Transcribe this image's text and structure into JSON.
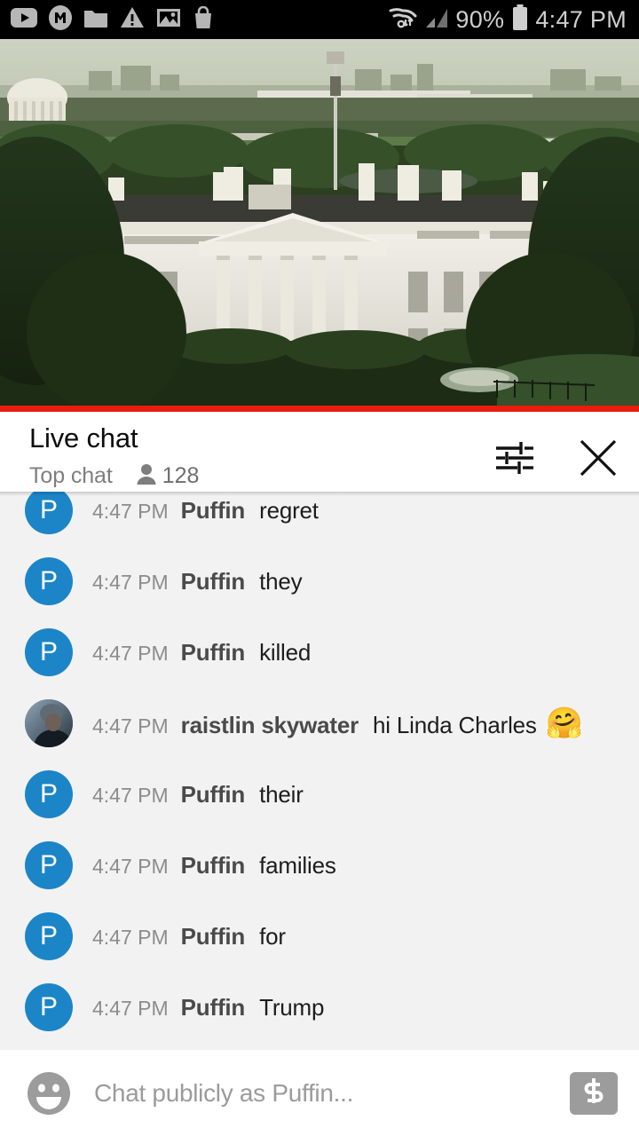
{
  "status_bar": {
    "icons_left": [
      "youtube-icon",
      "m-circle-icon",
      "folder-icon",
      "warning-triangle-icon",
      "image-icon",
      "shopping-bag-icon"
    ],
    "wifi_icon": "wifi-data-icon",
    "signal_icon": "cell-signal-icon",
    "battery_percent": "90%",
    "battery_icon": "battery-icon",
    "time": "4:47 PM",
    "background": "#000000",
    "foreground": "#cfcfcf"
  },
  "video": {
    "name": "white-house-live-stream",
    "progress_color": "#e81c0e",
    "progress_percent": 100
  },
  "chat_header": {
    "title": "Live chat",
    "mode": "Top chat",
    "viewer_icon": "person-icon",
    "viewer_count": "128",
    "settings_icon": "tune-sliders-icon",
    "close_icon": "close-icon"
  },
  "messages": [
    {
      "avatar_type": "letter",
      "avatar_letter": "P",
      "avatar_color": "#1b85c8",
      "time": "4:47 PM",
      "author": "Puffin",
      "text": "regret",
      "emoji": ""
    },
    {
      "avatar_type": "letter",
      "avatar_letter": "P",
      "avatar_color": "#1b85c8",
      "time": "4:47 PM",
      "author": "Puffin",
      "text": "they",
      "emoji": ""
    },
    {
      "avatar_type": "letter",
      "avatar_letter": "P",
      "avatar_color": "#1b85c8",
      "time": "4:47 PM",
      "author": "Puffin",
      "text": "killed",
      "emoji": ""
    },
    {
      "avatar_type": "photo",
      "avatar_letter": "",
      "avatar_color": "#4a5a68",
      "time": "4:47 PM",
      "author": "raistlin skywater",
      "text": "hi Linda Charles",
      "emoji": "🤗"
    },
    {
      "avatar_type": "letter",
      "avatar_letter": "P",
      "avatar_color": "#1b85c8",
      "time": "4:47 PM",
      "author": "Puffin",
      "text": "their",
      "emoji": ""
    },
    {
      "avatar_type": "letter",
      "avatar_letter": "P",
      "avatar_color": "#1b85c8",
      "time": "4:47 PM",
      "author": "Puffin",
      "text": "families",
      "emoji": ""
    },
    {
      "avatar_type": "letter",
      "avatar_letter": "P",
      "avatar_color": "#1b85c8",
      "time": "4:47 PM",
      "author": "Puffin",
      "text": "for",
      "emoji": ""
    },
    {
      "avatar_type": "letter",
      "avatar_letter": "P",
      "avatar_color": "#1b85c8",
      "time": "4:47 PM",
      "author": "Puffin",
      "text": "Trump",
      "emoji": ""
    }
  ],
  "input_bar": {
    "emoji_icon": "emoji-smiley-icon",
    "placeholder": "Chat publicly as Puffin...",
    "value": "",
    "superchat_icon": "dollar-sign-icon"
  }
}
